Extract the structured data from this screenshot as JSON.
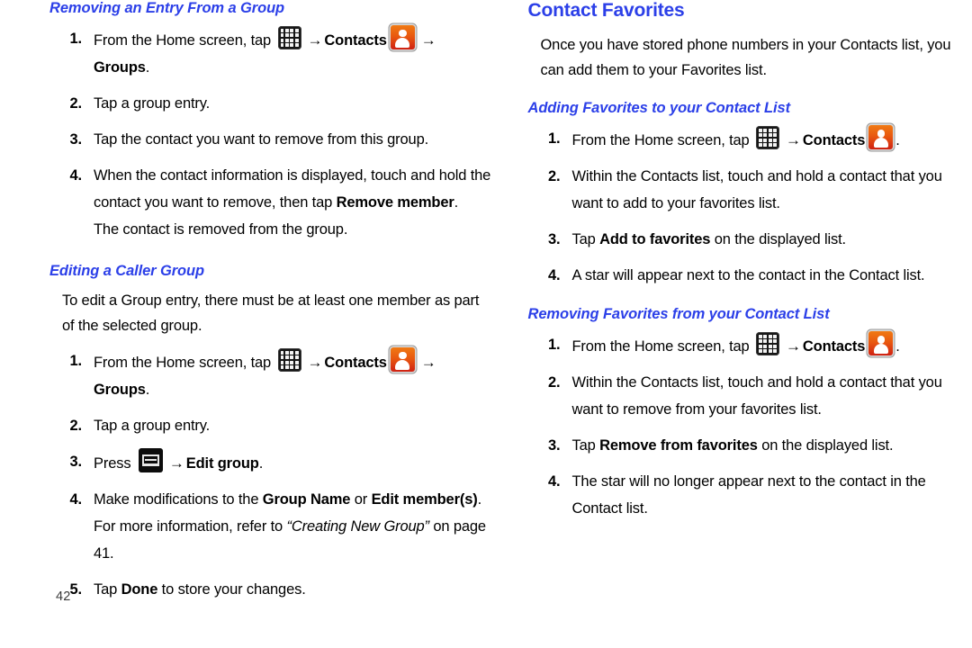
{
  "document": {
    "page_number": "42",
    "heading_color": "#2B3FE8",
    "icons": {
      "apps_grid": "apps-grid-icon",
      "contacts": "contacts-icon",
      "menu_key": "menu-key-icon",
      "arrow": "→"
    }
  },
  "left_column": {
    "section1": {
      "heading": "Removing an Entry From a Group",
      "steps": [
        {
          "num": "1.",
          "parts": [
            {
              "t": "text",
              "v": "From the Home screen, tap "
            },
            {
              "t": "icon",
              "v": "apps-grid-icon"
            },
            {
              "t": "arrow",
              "v": "→"
            },
            {
              "t": "bold",
              "v": "Contacts"
            },
            {
              "t": "icon",
              "v": "contacts-icon"
            },
            {
              "t": "arrow",
              "v": "→"
            }
          ],
          "second_line": [
            {
              "t": "bold",
              "v": "Groups"
            },
            {
              "t": "text",
              "v": "."
            }
          ]
        },
        {
          "num": "2.",
          "parts": [
            {
              "t": "text",
              "v": "Tap a group entry."
            }
          ]
        },
        {
          "num": "3.",
          "parts": [
            {
              "t": "text",
              "v": "Tap the contact you want to remove from this group."
            }
          ]
        },
        {
          "num": "4.",
          "parts": [
            {
              "t": "text",
              "v": "When the contact information is displayed, touch and hold the contact you want to remove, then tap "
            },
            {
              "t": "bold",
              "v": "Remove member"
            },
            {
              "t": "text",
              "v": "."
            }
          ],
          "second_line": [
            {
              "t": "text",
              "v": "The contact is removed from the group."
            }
          ]
        }
      ]
    },
    "section2": {
      "heading": "Editing a Caller Group",
      "intro": "To edit a Group entry, there must be at least one member as part of the selected group.",
      "steps": [
        {
          "num": "1.",
          "parts": [
            {
              "t": "text",
              "v": "From the Home screen, tap "
            },
            {
              "t": "icon",
              "v": "apps-grid-icon"
            },
            {
              "t": "arrow",
              "v": "→"
            },
            {
              "t": "bold",
              "v": "Contacts"
            },
            {
              "t": "icon",
              "v": "contacts-icon"
            },
            {
              "t": "arrow",
              "v": "→"
            }
          ],
          "second_line": [
            {
              "t": "bold",
              "v": "Groups"
            },
            {
              "t": "text",
              "v": "."
            }
          ]
        },
        {
          "num": "2.",
          "parts": [
            {
              "t": "text",
              "v": "Tap a group entry."
            }
          ]
        },
        {
          "num": "3.",
          "parts": [
            {
              "t": "text",
              "v": "Press "
            },
            {
              "t": "icon",
              "v": "menu-key-icon"
            },
            {
              "t": "arrow",
              "v": "→"
            },
            {
              "t": "bold",
              "v": "Edit group"
            },
            {
              "t": "text",
              "v": "."
            }
          ]
        },
        {
          "num": "4.",
          "parts": [
            {
              "t": "text",
              "v": "Make modifications to the "
            },
            {
              "t": "bold",
              "v": "Group Name"
            },
            {
              "t": "text",
              "v": " or "
            },
            {
              "t": "bold",
              "v": "Edit member(s)"
            },
            {
              "t": "text",
              "v": "."
            }
          ],
          "second_line": [
            {
              "t": "text",
              "v": "For more information, refer to "
            },
            {
              "t": "italic",
              "v": "“Creating New Group”"
            },
            {
              "t": "text",
              "v": " on page 41."
            }
          ]
        },
        {
          "num": "5.",
          "parts": [
            {
              "t": "text",
              "v": "Tap "
            },
            {
              "t": "bold",
              "v": "Done"
            },
            {
              "t": "text",
              "v": " to store your changes."
            }
          ]
        }
      ]
    }
  },
  "right_column": {
    "section1": {
      "heading": "Contact Favorites",
      "intro": "Once you have stored phone numbers in your Contacts list, you can add them to your Favorites list."
    },
    "section2": {
      "heading": "Adding Favorites to your Contact List",
      "steps": [
        {
          "num": "1.",
          "parts": [
            {
              "t": "text",
              "v": "From the Home screen, tap "
            },
            {
              "t": "icon",
              "v": "apps-grid-icon"
            },
            {
              "t": "arrow",
              "v": "→"
            },
            {
              "t": "bold",
              "v": "Contacts"
            },
            {
              "t": "icon",
              "v": "contacts-icon"
            },
            {
              "t": "text",
              "v": "."
            }
          ]
        },
        {
          "num": "2.",
          "parts": [
            {
              "t": "text",
              "v": "Within the Contacts list, touch and hold a contact that you want to add to your favorites list."
            }
          ]
        },
        {
          "num": "3.",
          "parts": [
            {
              "t": "text",
              "v": "Tap "
            },
            {
              "t": "bold",
              "v": "Add to favorites"
            },
            {
              "t": "text",
              "v": " on the displayed list."
            }
          ]
        },
        {
          "num": "4.",
          "parts": [
            {
              "t": "text",
              "v": "A star will appear next to the contact in the Contact list."
            }
          ]
        }
      ]
    },
    "section3": {
      "heading": "Removing Favorites from your Contact List",
      "steps": [
        {
          "num": "1.",
          "parts": [
            {
              "t": "text",
              "v": "From the Home screen, tap "
            },
            {
              "t": "icon",
              "v": "apps-grid-icon"
            },
            {
              "t": "arrow",
              "v": "→"
            },
            {
              "t": "bold",
              "v": "Contacts"
            },
            {
              "t": "icon",
              "v": "contacts-icon"
            },
            {
              "t": "text",
              "v": "."
            }
          ]
        },
        {
          "num": "2.",
          "parts": [
            {
              "t": "text",
              "v": "Within the Contacts list, touch and hold a contact that you want to remove from your favorites list."
            }
          ]
        },
        {
          "num": "3.",
          "parts": [
            {
              "t": "text",
              "v": "Tap "
            },
            {
              "t": "bold",
              "v": "Remove from favorites"
            },
            {
              "t": "text",
              "v": " on the displayed list."
            }
          ]
        },
        {
          "num": "4.",
          "parts": [
            {
              "t": "text",
              "v": "The star will no longer appear next to the contact in the Contact list."
            }
          ]
        }
      ]
    }
  }
}
